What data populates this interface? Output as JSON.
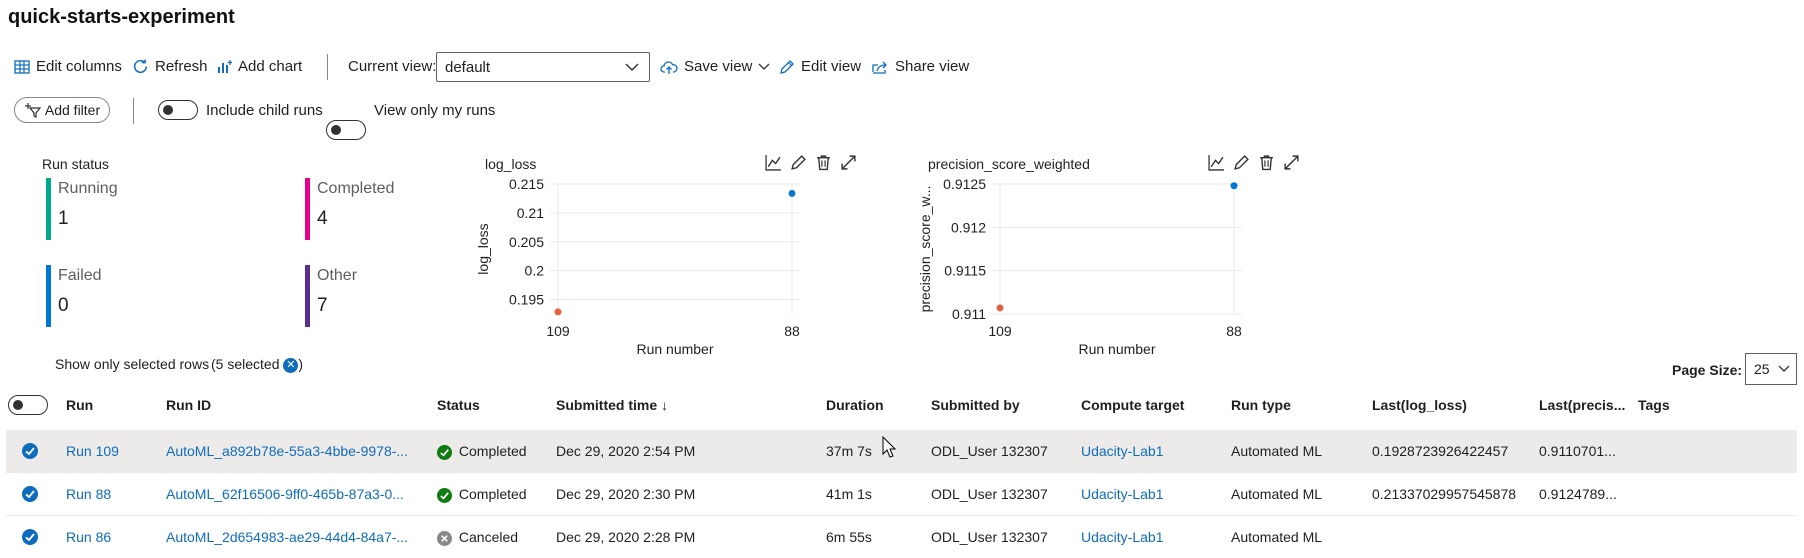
{
  "experiment_title": "quick-starts-experiment",
  "toolbar": {
    "edit_columns": "Edit columns",
    "refresh": "Refresh",
    "add_chart": "Add chart",
    "current_view_label": "Current view:",
    "current_view_value": "default",
    "save_view": "Save view",
    "edit_view": "Edit view",
    "share_view": "Share view"
  },
  "filters": {
    "add_filter": "Add filter",
    "include_child_runs": "Include child runs",
    "view_only_my_runs": "View only my runs"
  },
  "run_status": {
    "title": "Run status",
    "tiles": [
      {
        "label": "Running",
        "count": "1",
        "color": "#00a88f"
      },
      {
        "label": "Completed",
        "count": "4",
        "color": "#e3008c"
      },
      {
        "label": "Failed",
        "count": "0",
        "color": "#0078d4"
      },
      {
        "label": "Other",
        "count": "7",
        "color": "#5c2d91"
      }
    ]
  },
  "chart_data": [
    {
      "type": "scatter",
      "title": "log_loss",
      "xlabel": "Run number",
      "ylabel": "log_loss",
      "categories": [
        "109",
        "88"
      ],
      "yticks": [
        "0.215",
        "0.21",
        "0.205",
        "0.2",
        "0.195"
      ],
      "ylim": [
        0.1925,
        0.215
      ],
      "points": [
        {
          "x": "109",
          "y": 0.1928723926422457,
          "color": "#e8603c"
        },
        {
          "x": "88",
          "y": 0.21337029957545878,
          "color": "#0078d4"
        }
      ]
    },
    {
      "type": "scatter",
      "title": "precision_score_weighted",
      "xlabel": "Run number",
      "ylabel": "precision_score_w...",
      "categories": [
        "109",
        "88"
      ],
      "yticks": [
        "0.9125",
        "0.912",
        "0.9115",
        "0.911"
      ],
      "ylim": [
        0.911,
        0.9125
      ],
      "points": [
        {
          "x": "109",
          "y": 0.91107,
          "color": "#e8603c"
        },
        {
          "x": "88",
          "y": 0.91248,
          "color": "#0078d4"
        }
      ]
    }
  ],
  "selection": {
    "show_only_selected": "Show only selected rows",
    "selected_count": "(5 selected"
  },
  "page_size": {
    "label": "Page Size:",
    "value": "25"
  },
  "table": {
    "headers": {
      "run": "Run",
      "run_id": "Run ID",
      "status": "Status",
      "submitted_time": "Submitted time ↓",
      "duration": "Duration",
      "submitted_by": "Submitted by",
      "compute_target": "Compute target",
      "run_type": "Run type",
      "last_log_loss": "Last(log_loss)",
      "last_precision": "Last(precis...",
      "tags": "Tags"
    },
    "rows": [
      {
        "run": "Run 109",
        "run_id": "AutoML_a892b78e-55a3-4bbe-9978-...",
        "status": "Completed",
        "status_kind": "completed",
        "submitted_time": "Dec 29, 2020 2:54 PM",
        "duration": "37m 7s",
        "submitted_by": "ODL_User 132307",
        "compute_target": "Udacity-Lab1",
        "run_type": "Automated ML",
        "last_log_loss": "0.1928723926422457",
        "last_precision": "0.9110701..."
      },
      {
        "run": "Run 88",
        "run_id": "AutoML_62f16506-9ff0-465b-87a3-0...",
        "status": "Completed",
        "status_kind": "completed",
        "submitted_time": "Dec 29, 2020 2:30 PM",
        "duration": "41m 1s",
        "submitted_by": "ODL_User 132307",
        "compute_target": "Udacity-Lab1",
        "run_type": "Automated ML",
        "last_log_loss": "0.21337029957545878",
        "last_precision": "0.9124789..."
      },
      {
        "run": "Run 86",
        "run_id": "AutoML_2d654983-ae29-44d4-84a7-...",
        "status": "Canceled",
        "status_kind": "canceled",
        "submitted_time": "Dec 29, 2020 2:28 PM",
        "duration": "6m 55s",
        "submitted_by": "ODL_User 132307",
        "compute_target": "Udacity-Lab1",
        "run_type": "Automated ML",
        "last_log_loss": "",
        "last_precision": ""
      }
    ]
  }
}
